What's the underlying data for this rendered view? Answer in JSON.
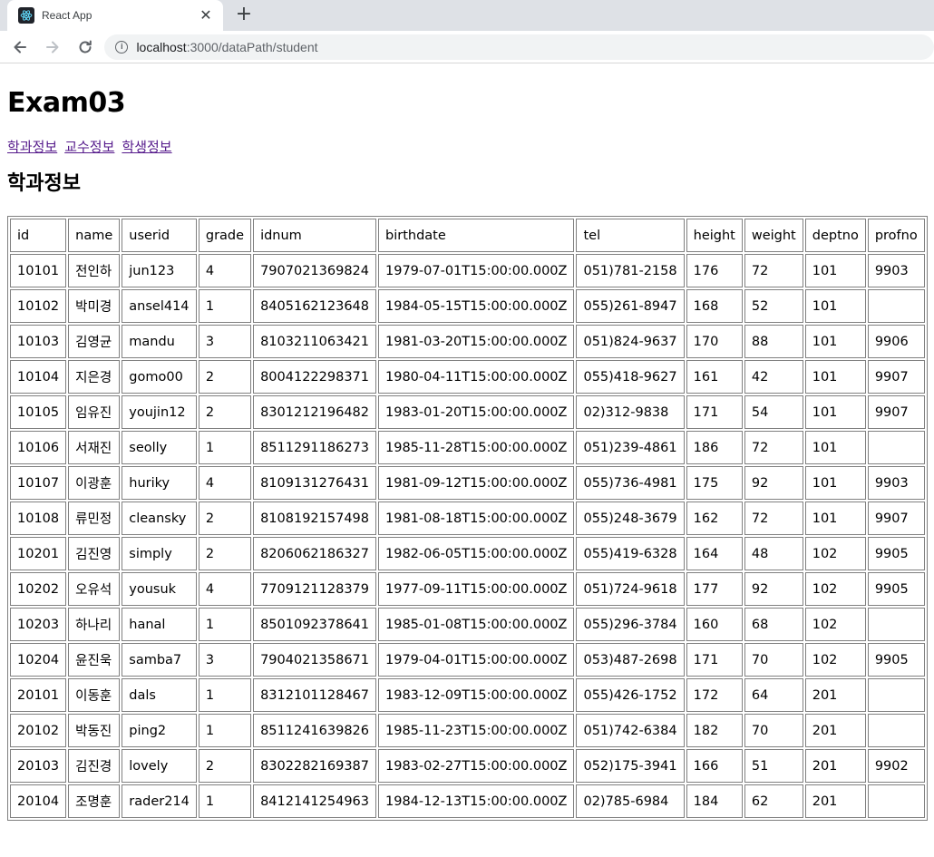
{
  "browser": {
    "tab_title": "React App",
    "url_host": "localhost",
    "url_rest": ":3000/dataPath/student"
  },
  "page": {
    "title": "Exam03",
    "nav_links": [
      "학과정보",
      "교수정보",
      "학생정보"
    ],
    "section_title": "학과정보"
  },
  "table": {
    "columns": [
      "id",
      "name",
      "userid",
      "grade",
      "idnum",
      "birthdate",
      "tel",
      "height",
      "weight",
      "deptno",
      "profno"
    ],
    "rows": [
      [
        "10101",
        "전인하",
        "jun123",
        "4",
        "7907021369824",
        "1979-07-01T15:00:00.000Z",
        "051)781-2158",
        "176",
        "72",
        "101",
        "9903"
      ],
      [
        "10102",
        "박미경",
        "ansel414",
        "1",
        "8405162123648",
        "1984-05-15T15:00:00.000Z",
        "055)261-8947",
        "168",
        "52",
        "101",
        ""
      ],
      [
        "10103",
        "김영균",
        "mandu",
        "3",
        "8103211063421",
        "1981-03-20T15:00:00.000Z",
        "051)824-9637",
        "170",
        "88",
        "101",
        "9906"
      ],
      [
        "10104",
        "지은경",
        "gomo00",
        "2",
        "8004122298371",
        "1980-04-11T15:00:00.000Z",
        "055)418-9627",
        "161",
        "42",
        "101",
        "9907"
      ],
      [
        "10105",
        "임유진",
        "youjin12",
        "2",
        "8301212196482",
        "1983-01-20T15:00:00.000Z",
        "02)312-9838",
        "171",
        "54",
        "101",
        "9907"
      ],
      [
        "10106",
        "서재진",
        "seolly",
        "1",
        "8511291186273",
        "1985-11-28T15:00:00.000Z",
        "051)239-4861",
        "186",
        "72",
        "101",
        ""
      ],
      [
        "10107",
        "이광훈",
        "huriky",
        "4",
        "8109131276431",
        "1981-09-12T15:00:00.000Z",
        "055)736-4981",
        "175",
        "92",
        "101",
        "9903"
      ],
      [
        "10108",
        "류민정",
        "cleansky",
        "2",
        "8108192157498",
        "1981-08-18T15:00:00.000Z",
        "055)248-3679",
        "162",
        "72",
        "101",
        "9907"
      ],
      [
        "10201",
        "김진영",
        "simply",
        "2",
        "8206062186327",
        "1982-06-05T15:00:00.000Z",
        "055)419-6328",
        "164",
        "48",
        "102",
        "9905"
      ],
      [
        "10202",
        "오유석",
        "yousuk",
        "4",
        "7709121128379",
        "1977-09-11T15:00:00.000Z",
        "051)724-9618",
        "177",
        "92",
        "102",
        "9905"
      ],
      [
        "10203",
        "하나리",
        "hanal",
        "1",
        "8501092378641",
        "1985-01-08T15:00:00.000Z",
        "055)296-3784",
        "160",
        "68",
        "102",
        ""
      ],
      [
        "10204",
        "윤진욱",
        "samba7",
        "3",
        "7904021358671",
        "1979-04-01T15:00:00.000Z",
        "053)487-2698",
        "171",
        "70",
        "102",
        "9905"
      ],
      [
        "20101",
        "이동훈",
        "dals",
        "1",
        "8312101128467",
        "1983-12-09T15:00:00.000Z",
        "055)426-1752",
        "172",
        "64",
        "201",
        ""
      ],
      [
        "20102",
        "박동진",
        "ping2",
        "1",
        "8511241639826",
        "1985-11-23T15:00:00.000Z",
        "051)742-6384",
        "182",
        "70",
        "201",
        ""
      ],
      [
        "20103",
        "김진경",
        "lovely",
        "2",
        "8302282169387",
        "1983-02-27T15:00:00.000Z",
        "052)175-3941",
        "166",
        "51",
        "201",
        "9902"
      ],
      [
        "20104",
        "조명훈",
        "rader214",
        "1",
        "8412141254963",
        "1984-12-13T15:00:00.000Z",
        "02)785-6984",
        "184",
        "62",
        "201",
        ""
      ]
    ]
  }
}
